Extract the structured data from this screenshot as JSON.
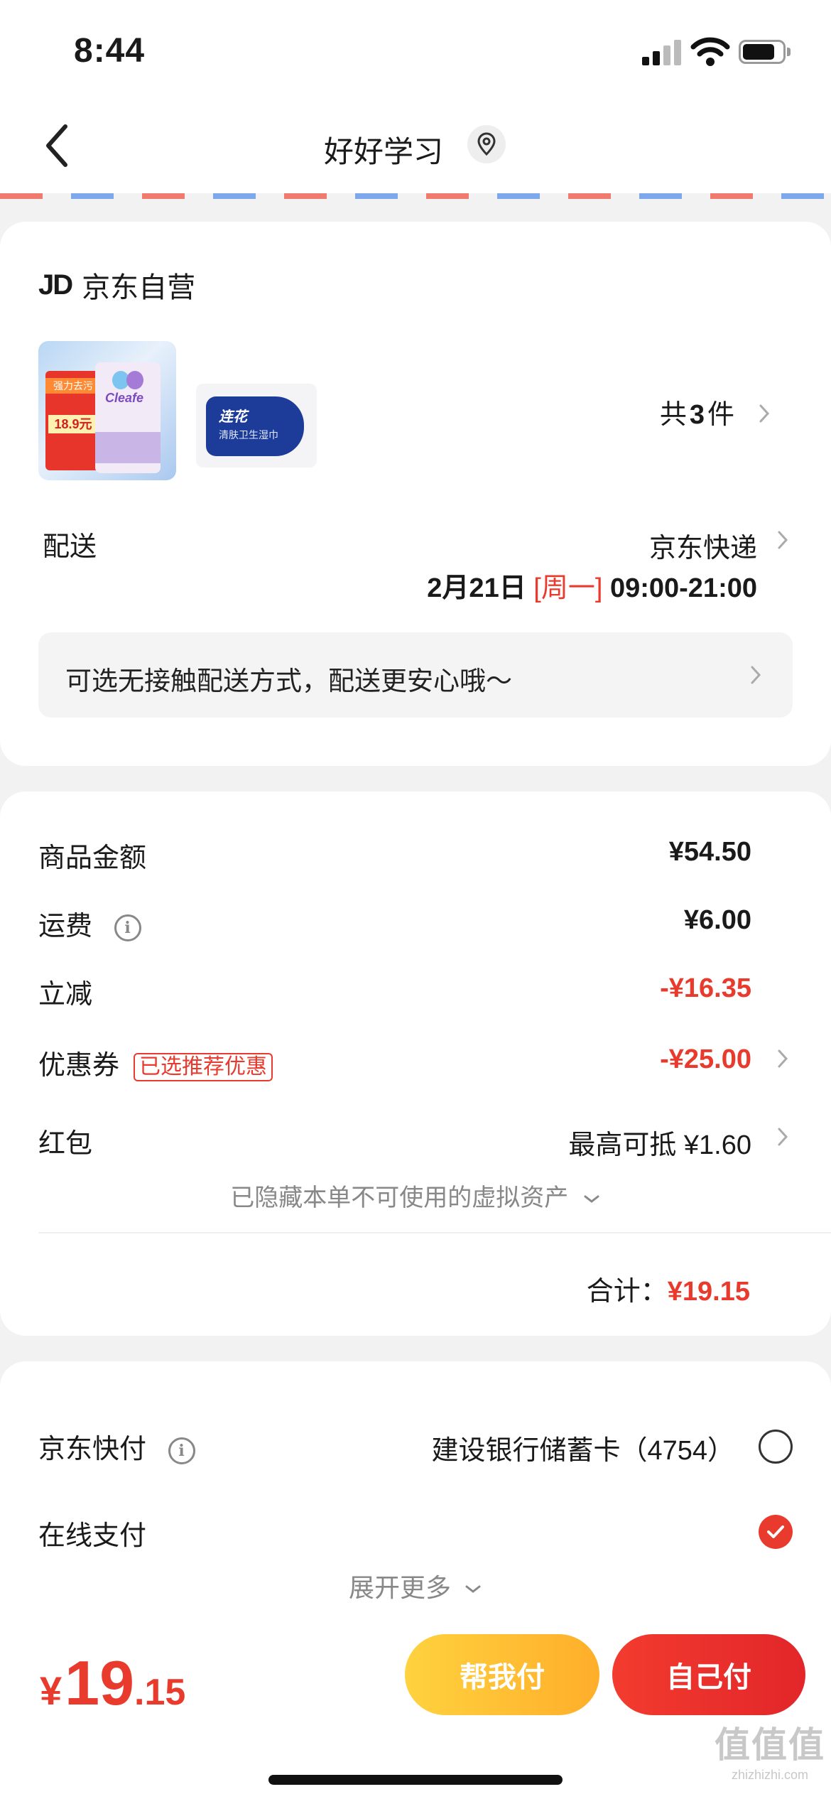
{
  "status_bar": {
    "time": "8:44"
  },
  "nav": {
    "title": "好好学习"
  },
  "shop": {
    "logo": "JD",
    "name": "京东自营"
  },
  "items": {
    "thumb1_band": "强力去污",
    "thumb1_price": "18.9元",
    "thumb1_brand": "Cleafe",
    "thumb2_brand": "连花",
    "thumb2_sub": "清肤卫生湿巾",
    "count_prefix": "共",
    "count": "3",
    "count_suffix": "件"
  },
  "delivery": {
    "label": "配送",
    "method": "京东快递",
    "date": "2月21日",
    "weekday": "[周一]",
    "time_range": "09:00-21:00",
    "contactless_tip": "可选无接触配送方式，配送更安心哦～"
  },
  "summary": {
    "goods_label": "商品金额",
    "goods_value": "¥54.50",
    "shipping_label": "运费",
    "shipping_value": "¥6.00",
    "discount_label": "立减",
    "discount_value": "-¥16.35",
    "coupon_label": "优惠券",
    "coupon_badge": "已选推荐优惠",
    "coupon_value": "-¥25.00",
    "redpacket_label": "红包",
    "redpacket_value": "最高可抵 ¥1.60",
    "hidden_assets": "已隐藏本单不可使用的虚拟资产",
    "total_label": "合计：",
    "total_value": "¥19.15"
  },
  "payment": {
    "quickpay_label": "京东快付",
    "quickpay_card": "建设银行储蓄卡（4754）",
    "online_label": "在线支付",
    "expand_more": "展开更多"
  },
  "bottom": {
    "currency": "¥",
    "amount_int": "19",
    "amount_dec": ".15",
    "help_pay": "帮我付",
    "self_pay": "自己付"
  },
  "watermark": {
    "big": "值值值",
    "small": "zhizhizhi.com"
  },
  "colors": {
    "accent_red": "#e83b2e",
    "help_yellow": "#ffc135",
    "background": "#f2f2f2"
  }
}
